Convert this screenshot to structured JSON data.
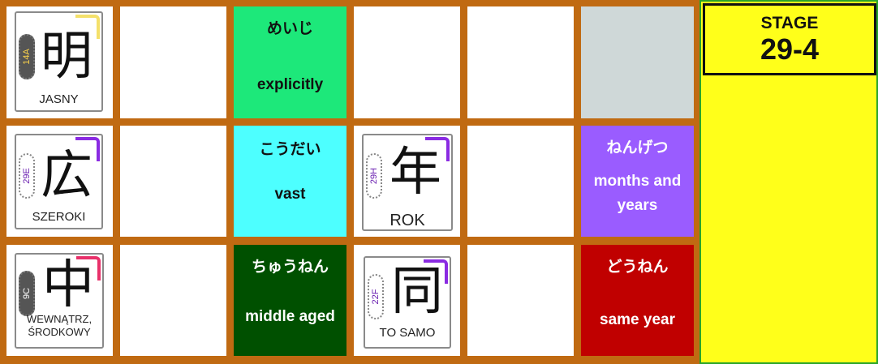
{
  "stage": {
    "label": "STAGE",
    "number": "29-4"
  },
  "kanji_cards": [
    {
      "kanji": "明",
      "meaning": "JASNY",
      "code": "14A"
    },
    {
      "kanji": "広",
      "meaning": "SZEROKI",
      "code": "29E"
    },
    {
      "kanji": "年",
      "meaning": "ROK",
      "code": "29H"
    },
    {
      "kanji": "中",
      "meaning": "WEWNĄTRZ, ŚRODKOWY",
      "code": "9C"
    },
    {
      "kanji": "同",
      "meaning": "TO SAMO",
      "code": "22F"
    }
  ],
  "vocab_tiles": [
    {
      "kana": "めいじ",
      "english": "explicitly"
    },
    {
      "kana": "こうだい",
      "english": "vast"
    },
    {
      "kana": "ねんげつ",
      "english": "months and years"
    },
    {
      "kana": "ちゅうねん",
      "english": "middle aged"
    },
    {
      "kana": "どうねん",
      "english": "same year"
    }
  ],
  "colors": {
    "board": "#c06a12",
    "panel": "#ffff1a",
    "explicitly": "#1de87a",
    "vast": "#4dffff",
    "months_and_years": "#9a5cff",
    "middle_aged": "#005000",
    "same_year": "#c00000",
    "empty_slot": "#cfd8d8"
  }
}
